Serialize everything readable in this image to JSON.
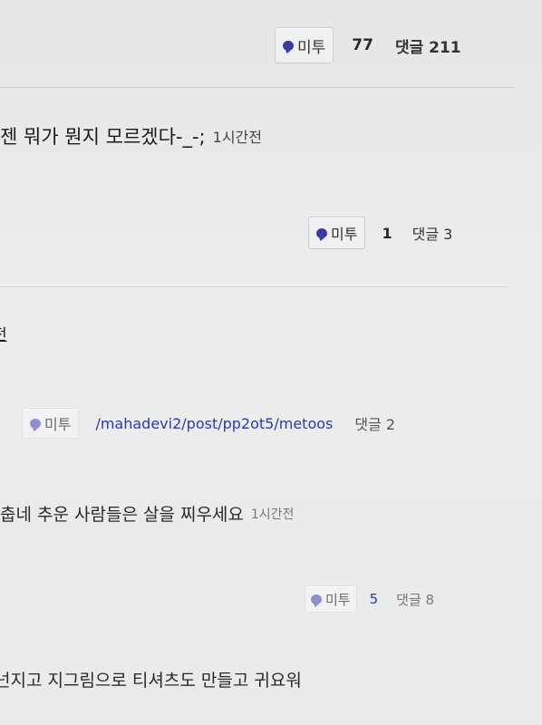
{
  "posts": [
    {
      "actions": {
        "metoo_label": "미투",
        "metoo_count": "77",
        "comments_label": "댓글 211"
      }
    },
    {
      "text": "젠 뭐가 뭔지 모르겠다-_-;",
      "time": "1시간전",
      "actions": {
        "metoo_label": "미투",
        "metoo_count": "1",
        "comments_label": "댓글 3"
      }
    },
    {
      "text": "전",
      "actions": {
        "metoo_label": "미투",
        "link": "/mahadevi2/post/pp2ot5/metoos",
        "comments_label": "댓글 2"
      }
    },
    {
      "text": "춥네 추운 사람들은 살을 찌우세요",
      "time": "1시간전",
      "actions": {
        "metoo_label": "미투",
        "metoo_count": "5",
        "comments_label": "댓글 8"
      }
    },
    {
      "text": "넌지고 지그림으로 티셔츠도 만들고 귀요워"
    }
  ],
  "colors": {
    "bubble": "#3a3aa6",
    "link": "#2c3aa8",
    "background": "#e9ebea"
  }
}
